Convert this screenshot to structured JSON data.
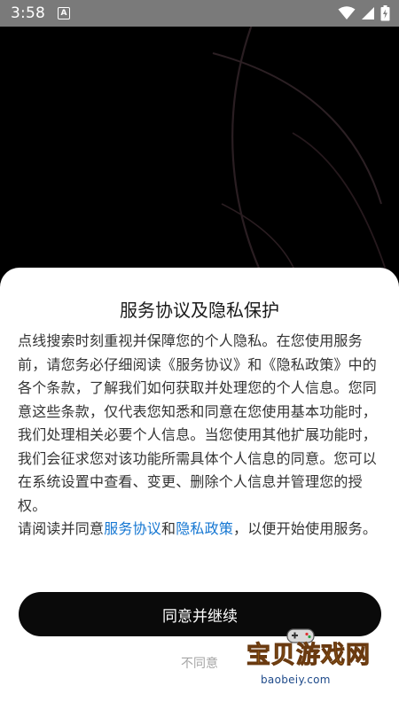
{
  "status_bar": {
    "time": "3:58",
    "notification_badge": "A",
    "icons": [
      "wifi-icon",
      "signal-icon",
      "battery-icon"
    ]
  },
  "dialog": {
    "title": "服务协议及隐私保护",
    "body_paragraph": "点线搜索时刻重视并保障您的个人隐私。在您使用服务前，请您务必仔细阅读《服务协议》和《隐私政策》中的各个条款，了解我们如何获取并处理您的个人信息。您同意这些条款，仅代表您知悉和同意在您使用基本功能时，我们处理相关必要个人信息。当您使用其他扩展功能时，我们会征求您对该功能所需具体个人信息的同意。您可以在系统设置中查看、变更、删除个人信息并管理您的授权。",
    "read_prefix": "请阅读并同意",
    "service_link": "服务协议",
    "conjunction": "和",
    "privacy_link": "隐私政策",
    "read_suffix": "，以便开始使用服务。",
    "agree_label": "同意并继续",
    "disagree_label": "不同意"
  },
  "watermark": {
    "title": "宝贝游戏网",
    "url": "baobeiy.com"
  },
  "colors": {
    "link": "#1677d2",
    "primary_button": "#0a0a0a",
    "status_bar": "#7a7a7a"
  }
}
